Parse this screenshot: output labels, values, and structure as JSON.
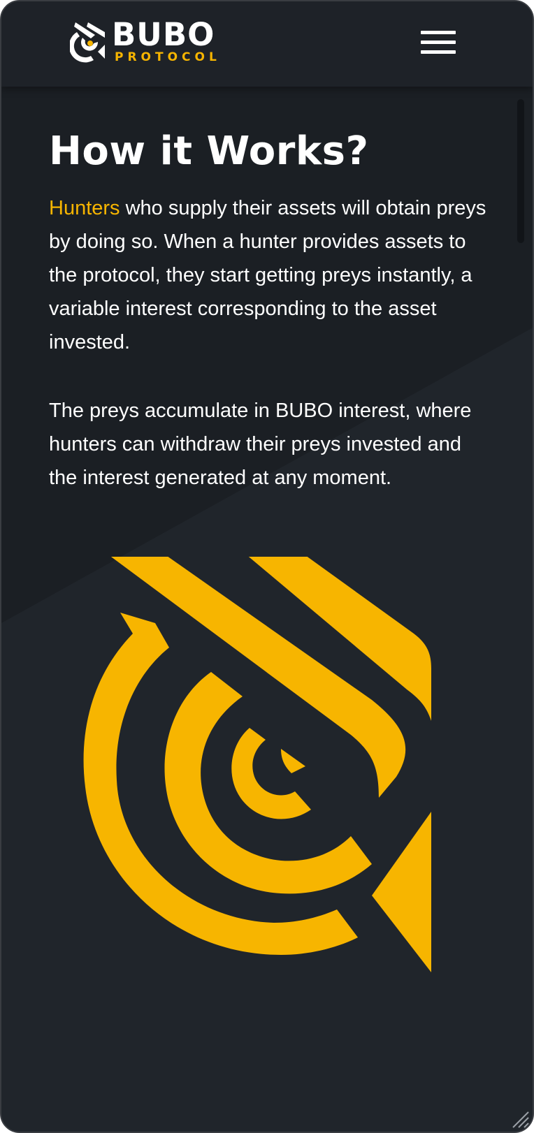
{
  "brand": {
    "name": "BUBO",
    "subtitle": "PROTOCOL",
    "accent_color": "#f7b500",
    "background_color": "#20252b"
  },
  "header": {
    "menu_icon": "hamburger-menu-icon"
  },
  "section": {
    "title": "How it Works?",
    "paragraph1": {
      "highlight": "Hunters",
      "text": " who supply their assets will obtain preys by doing so. When a hunter provides assets to the protocol, they start getting preys instantly, a variable interest corresponding to the asset invested."
    },
    "paragraph2": "The preys accumulate in BUBO interest, where hunters can withdraw their preys invested and the interest generated at any moment."
  },
  "illustration": {
    "icon": "bubo-owl-eye-logo-icon"
  }
}
